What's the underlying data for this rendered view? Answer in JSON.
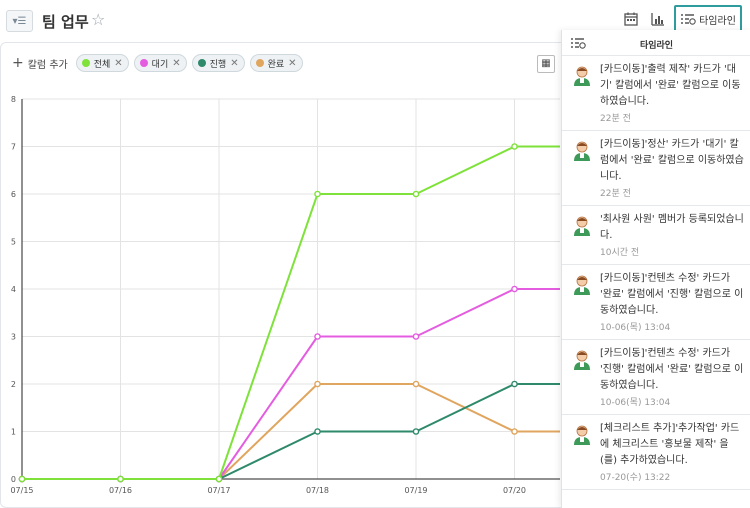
{
  "header": {
    "title": "팀 업무",
    "menu_icon": "filter-list-icon",
    "star_icon": "star-outline-icon",
    "calendar_icon": "calendar-icon",
    "chart_icon": "bar-chart-icon",
    "timeline_label": "타임라인"
  },
  "toolbar": {
    "add_column_label": "칼럼 추가",
    "chips": [
      {
        "label": "전체",
        "color": "#7ee23a"
      },
      {
        "label": "대기",
        "color": "#e45de0"
      },
      {
        "label": "진행",
        "color": "#2e8a6a"
      },
      {
        "label": "완료",
        "color": "#e0a55e"
      }
    ]
  },
  "chart_data": {
    "type": "line",
    "x": [
      "07/15",
      "07/16",
      "07/17",
      "07/18",
      "07/19",
      "07/20"
    ],
    "y_ticks": [
      0,
      1,
      2,
      3,
      4,
      5,
      6,
      7,
      8
    ],
    "ylim": [
      0,
      8
    ],
    "grid": true,
    "series": [
      {
        "name": "전체",
        "color": "#7ee23a",
        "values": [
          0,
          0,
          0,
          6,
          6,
          7
        ]
      },
      {
        "name": "대기",
        "color": "#e45de0",
        "values": [
          0,
          0,
          0,
          3,
          3,
          4
        ]
      },
      {
        "name": "진행",
        "color": "#2e8a6a",
        "values": [
          0,
          0,
          0,
          1,
          1,
          2
        ]
      },
      {
        "name": "완료",
        "color": "#e0a55e",
        "values": [
          0,
          0,
          0,
          2,
          2,
          1
        ]
      }
    ]
  },
  "timeline": {
    "title": "타임라인",
    "items": [
      {
        "text": "[카드이동]'출력 제작' 카드가 '대기' 칼럼에서 '완료' 칼럼으로 이동하였습니다.",
        "time": "22분 전"
      },
      {
        "text": "[카드이동]'정산' 카드가 '대기' 칼럼에서 '완료' 칼럼으로 이동하였습니다.",
        "time": "22분 전"
      },
      {
        "text": "'최사원 사원' 멤버가 등록되었습니다.",
        "time": "10시간 전"
      },
      {
        "text": "[카드이동]'컨텐츠 수정' 카드가 '완료' 칼럼에서 '진행' 칼럼으로 이동하였습니다.",
        "time": "10-06(목) 13:04"
      },
      {
        "text": "[카드이동]'컨텐츠 수정' 카드가 '진행' 칼럼에서 '완료' 칼럼으로 이동하였습니다.",
        "time": "10-06(목) 13:04"
      },
      {
        "text": "[체크리스트 추가]'추가작업' 카드에 체크리스트 '홍보물 제작' 을(를) 추가하였습니다.",
        "time": "07-20(수) 13:22"
      }
    ]
  }
}
